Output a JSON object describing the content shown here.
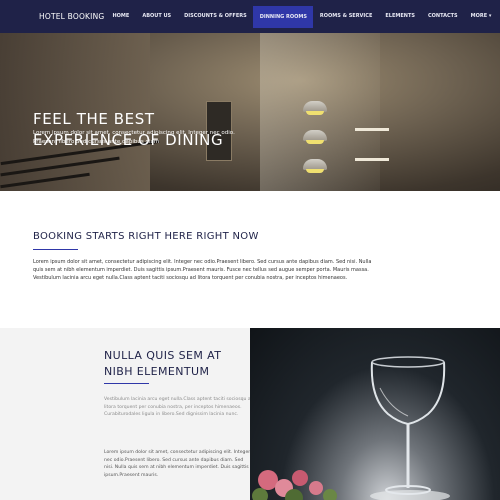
{
  "nav": {
    "brand": "HOTEL BOOKING",
    "items": [
      {
        "label": "HOME"
      },
      {
        "label": "ABOUT US"
      },
      {
        "label": "DISCOUNTS & OFFERS"
      },
      {
        "label": "DINNING ROOMS"
      },
      {
        "label": "ROOMS & SERVICE"
      },
      {
        "label": "ELEMENTS"
      },
      {
        "label": "CONTACTS"
      },
      {
        "label": "MORE ▾"
      }
    ],
    "active_index": 3,
    "colors": {
      "bar": "#1f2248",
      "active": "#2f37a8"
    }
  },
  "hero": {
    "title_line1": "FEEL THE BEST",
    "title_line2": "EXPERIENCE OF DINING",
    "subtitle_line1": "Lorem ipsum dolor sit amet, consectetur adipiscing elit. Integer nec odio.",
    "subtitle_line2": "Praesent libero Sed cursus ante dapibus diam"
  },
  "booking": {
    "title": "BOOKING STARTS RIGHT HERE RIGHT NOW",
    "text": "Lorem ipsum dolor sit amet, consectetur adipiscing elit. Integer nec odio.Praesent libero. Sed cursus ante dapibus diam. Sed nisi. Nulla quis sem at nibh elementum imperdiet. Duis sagittis ipsum.Praesent mauris. Fusce nec tellus sed augue semper porta. Mauris massa. Vestibulum lacinia arcu eget nulla.Class aptent taciti sociosqu ad litora torquent per conubia nostra, per inceptos himenaeos."
  },
  "section": {
    "title_line1": "NULLA QUIS SEM AT",
    "title_line2": "NIBH ELEMENTUM",
    "p1": "Vestibulum lacinia arcu eget nulla.Class aptent taciti sociosqu ad litora torquent per conubia nostra, per inceptos himenaeos. Curabiturodales ligula in libero.Sed dignissim lacinia nunc.",
    "p2": "Lorem ipsum dolor sit amet, consectetur adipiscing elit. Integer nec odio.Praesent libero. Sed cursus ante dapibus diam. Sed nisi. Nulla quis sem at nibh elementum imperdiet. Duis sagittis ipsum.Praesent mauris."
  }
}
